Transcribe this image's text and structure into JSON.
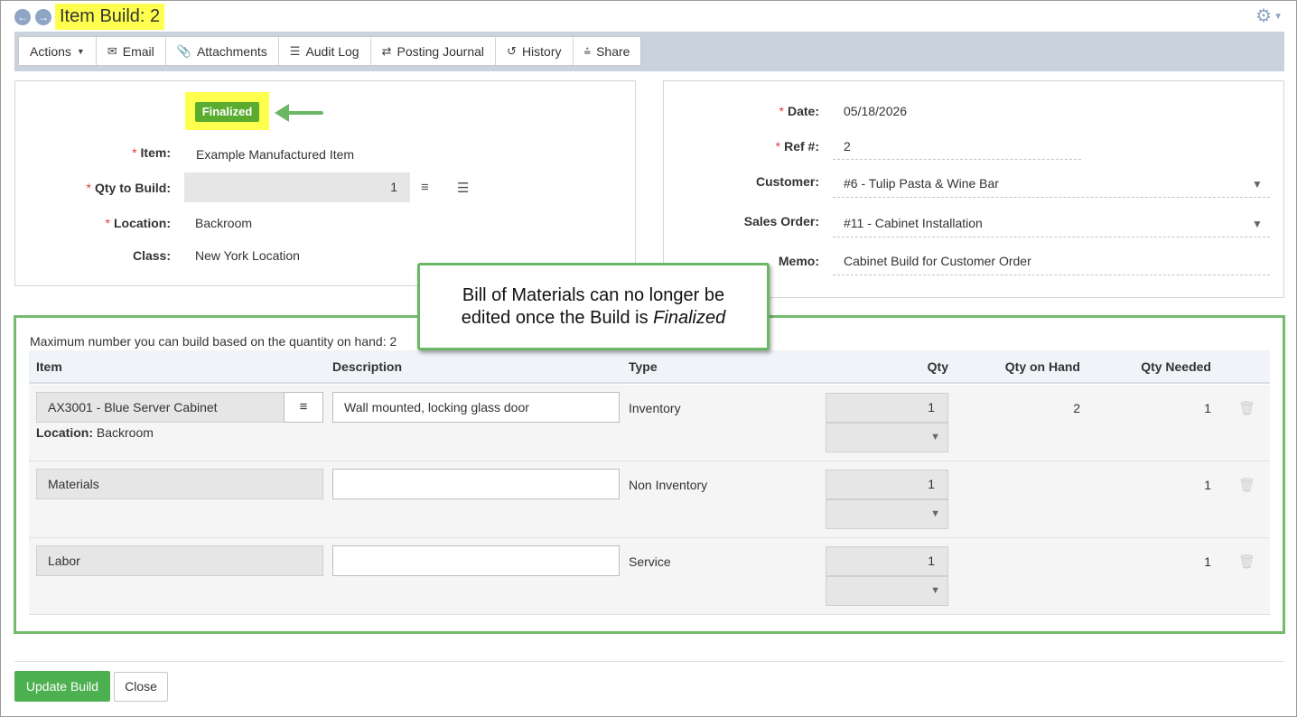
{
  "header": {
    "title": "Item Build: 2",
    "back_icon": "arrow-left-circle-icon",
    "forward_icon": "arrow-right-circle-icon",
    "settings_icon": "gear-icon"
  },
  "toolbar": {
    "actions": "Actions",
    "email": "Email",
    "attachments": "Attachments",
    "audit_log": "Audit Log",
    "posting_journal": "Posting Journal",
    "history": "History",
    "share": "Share"
  },
  "left_form": {
    "status": "Finalized",
    "item_label": "Item:",
    "item_value": "Example Manufactured Item",
    "qty_label": "Qty to Build:",
    "qty_value": "1",
    "location_label": "Location:",
    "location_value": "Backroom",
    "class_label": "Class:",
    "class_value": "New York Location"
  },
  "right_form": {
    "date_label": "Date:",
    "date_value": "05/18/2026",
    "ref_label": "Ref #:",
    "ref_value": "2",
    "customer_label": "Customer:",
    "customer_value": "#6 - Tulip Pasta & Wine Bar",
    "sales_order_label": "Sales Order:",
    "sales_order_value": "#11 - Cabinet Installation",
    "memo_label": "Memo:",
    "memo_value": "Cabinet Build for Customer Order"
  },
  "callout": {
    "line1": "Bill of Materials can no longer be",
    "line2_prefix": "edited once the Build is ",
    "line2_emphasis": "Finalized"
  },
  "bom": {
    "note": "Maximum number you can build based on the quantity on hand: 2",
    "headers": {
      "item": "Item",
      "description": "Description",
      "type": "Type",
      "qty": "Qty",
      "qty_on_hand": "Qty on Hand",
      "qty_needed": "Qty Needed"
    },
    "rows": [
      {
        "item": "AX3001 - Blue Server Cabinet",
        "location_label": "Location:",
        "location_value": "Backroom",
        "description": "Wall mounted, locking glass door",
        "type": "Inventory",
        "qty": "1",
        "qty_on_hand": "2",
        "qty_needed": "1"
      },
      {
        "item": "Materials",
        "description": "",
        "type": "Non Inventory",
        "qty": "1",
        "qty_on_hand": "",
        "qty_needed": "1"
      },
      {
        "item": "Labor",
        "description": "",
        "type": "Service",
        "qty": "1",
        "qty_on_hand": "",
        "qty_needed": "1"
      }
    ]
  },
  "footer": {
    "update_button": "Update Build",
    "close_button": "Close"
  },
  "colors": {
    "highlight": "#ffff4d",
    "status_green": "#5aac2e",
    "callout_border": "#6ab765",
    "primary_button": "#4caf50",
    "toolbar_bg": "#c9d2dd"
  }
}
